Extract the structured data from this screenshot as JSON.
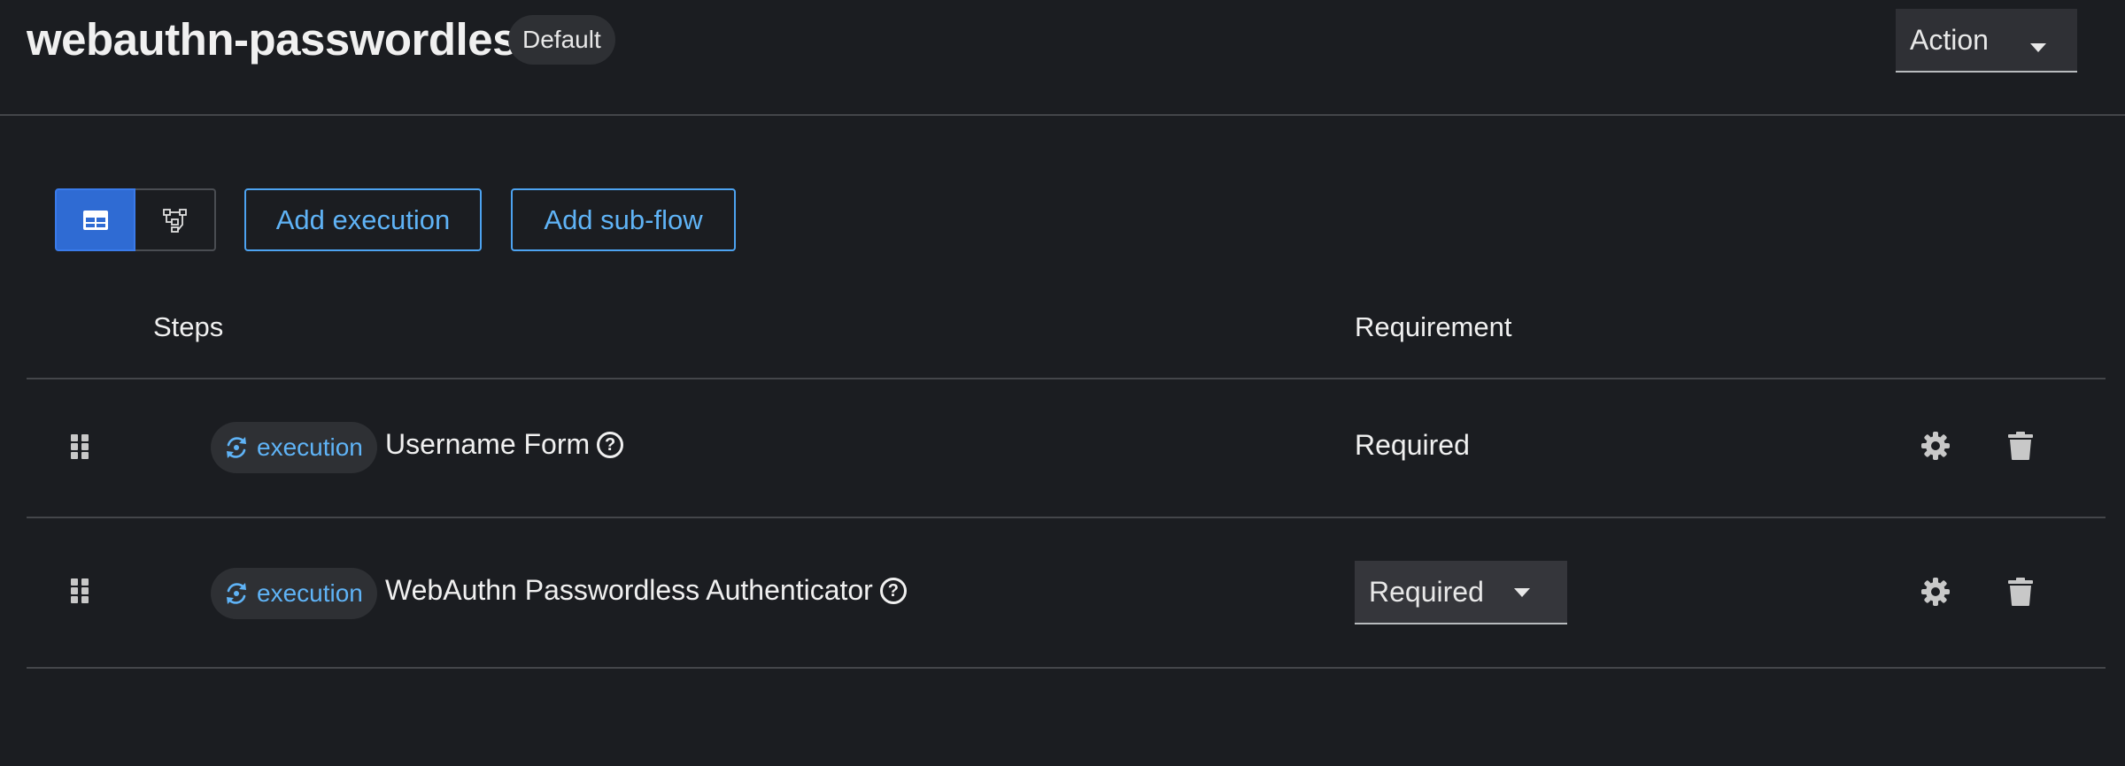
{
  "header": {
    "title": "webauthn-passwordless",
    "badge": "Default",
    "action_label": "Action"
  },
  "toolbar": {
    "view_toggle": {
      "table_view_icon": "table-view-icon",
      "diagram_view_icon": "diagram-view-icon",
      "active": "table"
    },
    "add_execution_label": "Add execution",
    "add_subflow_label": "Add sub-flow"
  },
  "table": {
    "columns": {
      "steps": "Steps",
      "requirement": "Requirement"
    },
    "rows": [
      {
        "type_label": "execution",
        "name": "Username Form",
        "requirement": "Required",
        "requirement_editable": false
      },
      {
        "type_label": "execution",
        "name": "WebAuthn Passwordless Authenticator",
        "requirement": "Required",
        "requirement_editable": true
      }
    ]
  },
  "colors": {
    "background": "#1b1d21",
    "accent": "#5fb3f6",
    "active_toggle": "#2f6bd3",
    "divider": "#44464a"
  }
}
